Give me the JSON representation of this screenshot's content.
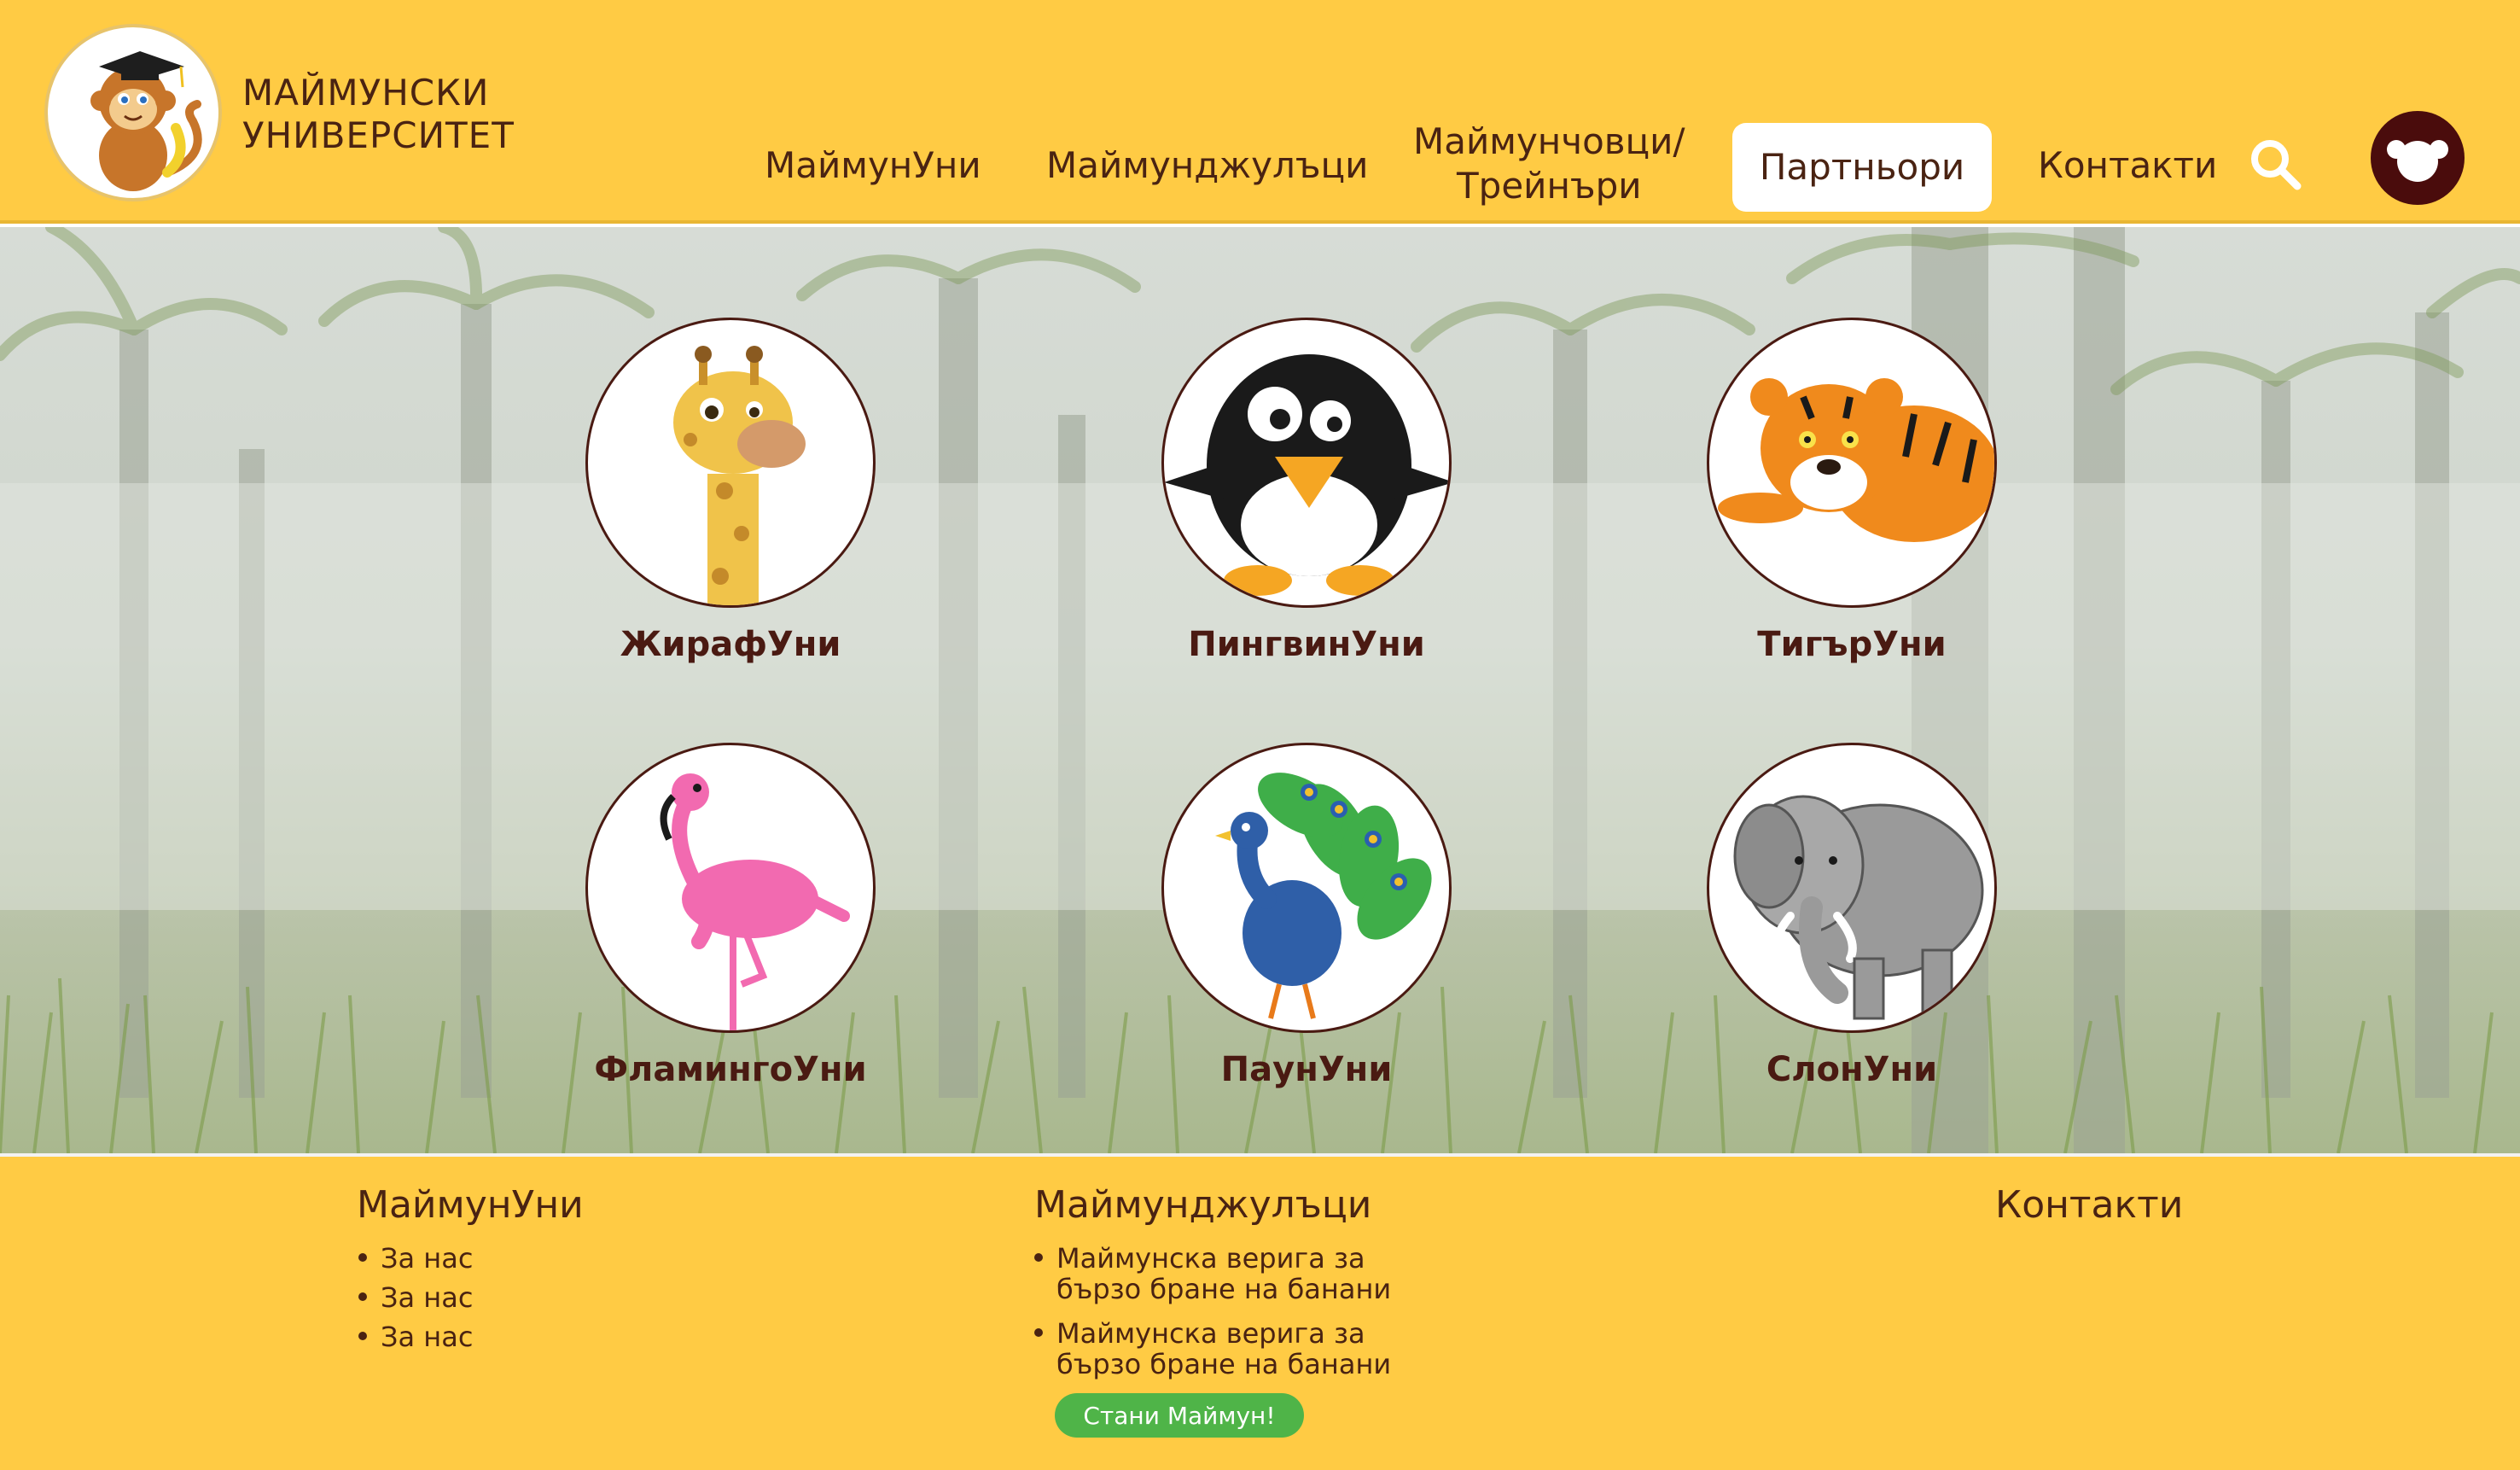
{
  "brand": {
    "name_line1": "МАЙМУНСКИ",
    "name_line2": "УНИВЕРСИТЕТ",
    "logo_icon": "monkey-graduate-logo"
  },
  "nav": {
    "items": [
      {
        "label": "МаймунУни"
      },
      {
        "label": "Маймунджулъци"
      },
      {
        "label_line1": "Маймунчовци/",
        "label_line2": "Трейнъри"
      },
      {
        "label": "Партньори",
        "active": true
      },
      {
        "label": "Контакти"
      }
    ],
    "search_icon": "search-icon",
    "avatar_icon": "monkey-face-icon"
  },
  "universities": [
    {
      "label": "ЖирафУни",
      "icon": "giraffe"
    },
    {
      "label": "ПингвинУни",
      "icon": "penguin"
    },
    {
      "label": "ТигърУни",
      "icon": "tiger"
    },
    {
      "label": "ФламингоУни",
      "icon": "flamingo"
    },
    {
      "label": "ПаунУни",
      "icon": "peacock"
    },
    {
      "label": "СлонУни",
      "icon": "elephant"
    }
  ],
  "footer": {
    "col1": {
      "title": "МаймунУни",
      "items": [
        "За нас",
        "За нас",
        "За нас"
      ]
    },
    "col2": {
      "title": "Маймунджулъци",
      "items": [
        {
          "line1": "Маймунска верига за",
          "line2": "бързо бране на банани"
        },
        {
          "line1": "Маймунска верига за",
          "line2": "бързо бране на банани"
        }
      ],
      "cta": "Стани Маймун!"
    },
    "col3": {
      "title": "Контакти"
    }
  },
  "colors": {
    "primary": "#ffcb44",
    "text": "#4a2312",
    "cta": "#4fb448",
    "avatar": "#4a0c0c"
  }
}
